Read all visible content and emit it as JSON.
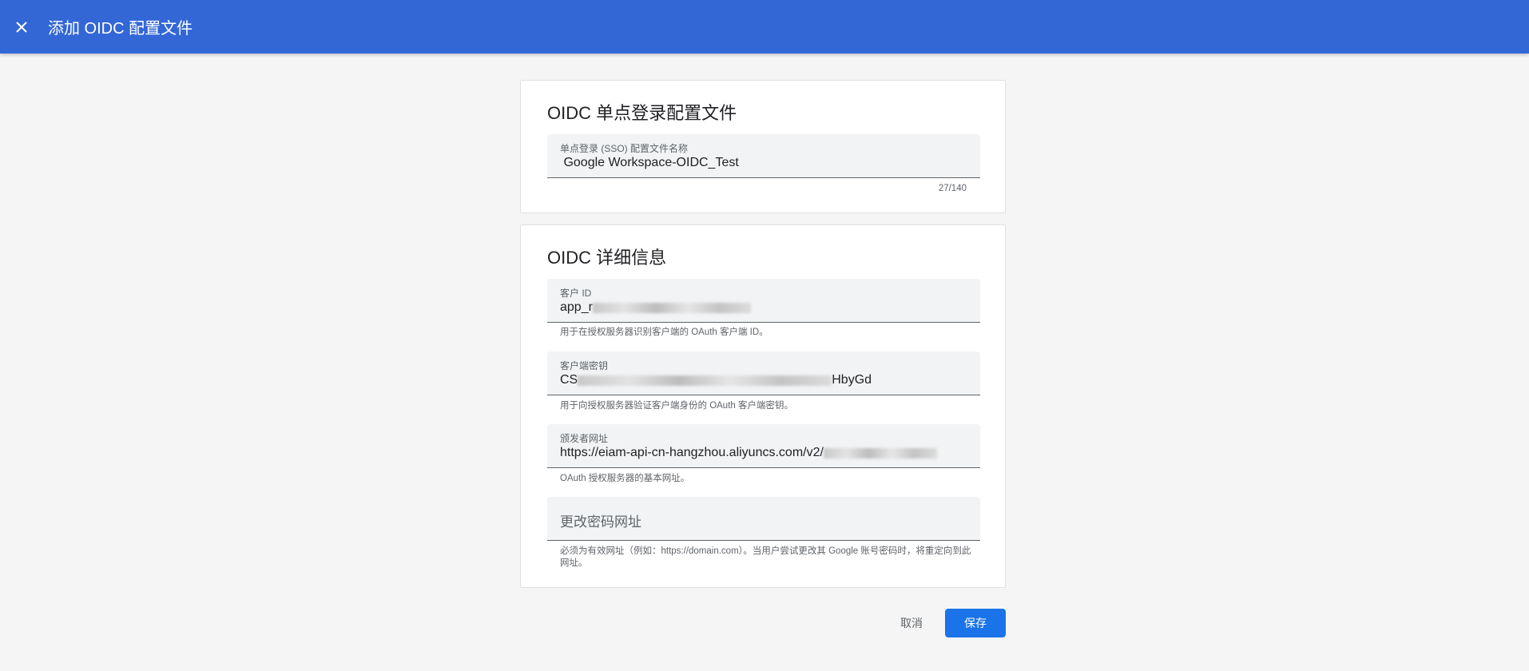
{
  "header": {
    "title": "添加 OIDC 配置文件",
    "close_icon": "close-icon"
  },
  "profile_card": {
    "title": "OIDC 单点登录配置文件",
    "name_field": {
      "label": "单点登录 (SSO) 配置文件名称",
      "value": " Google Workspace-OIDC_Test",
      "counter": "27/140"
    }
  },
  "details_card": {
    "title": "OIDC 详细信息",
    "client_id": {
      "label": "客户 ID",
      "value_prefix": "app_r",
      "helper": "用于在授权服务器识别客户端的 OAuth 客户端 ID。"
    },
    "client_secret": {
      "label": "客户端密钥",
      "value_prefix": "CS",
      "value_suffix": "HbyGd",
      "helper": "用于向授权服务器验证客户端身份的 OAuth 客户端密钥。"
    },
    "issuer_url": {
      "label": "颁发者网址",
      "value_prefix": "https://eiam-api-cn-hangzhou.aliyuncs.com/v2/",
      "helper": "OAuth 授权服务器的基本网址。"
    },
    "change_password_url": {
      "placeholder": "更改密码网址",
      "helper": "必须为有效网址（例如：https://domain.com）。当用户尝试更改其 Google 账号密码时，将重定向到此网址。"
    }
  },
  "actions": {
    "cancel": "取消",
    "save": "保存"
  },
  "colors": {
    "header": "#3367d6",
    "primary_button": "#1a73e8"
  }
}
